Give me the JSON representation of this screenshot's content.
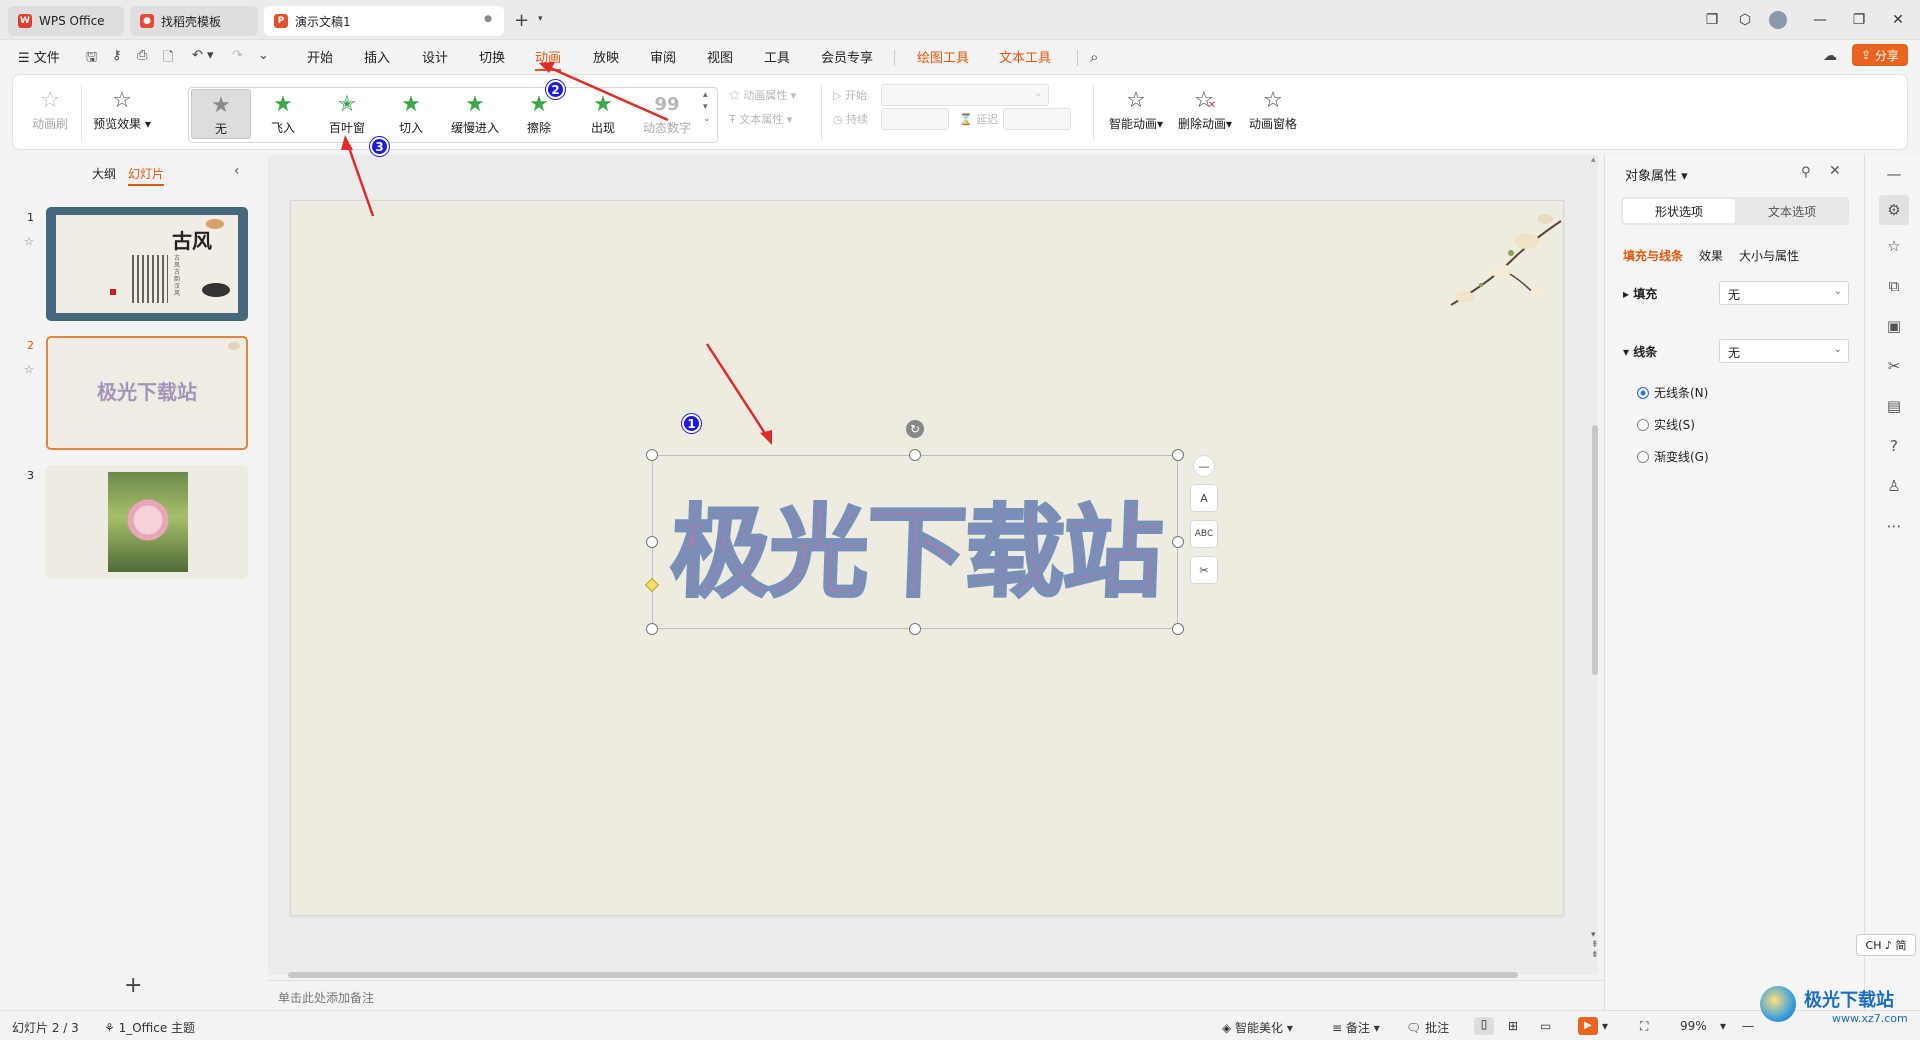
{
  "tabs": [
    {
      "label": "WPS Office",
      "icon": "wps-logo-icon"
    },
    {
      "label": "找稻壳模板",
      "icon": "docer-icon"
    },
    {
      "label": "演示文稿1",
      "icon": "presentation-icon"
    }
  ],
  "menu": {
    "file": "文件",
    "items": [
      "开始",
      "插入",
      "设计",
      "切换",
      "动画",
      "放映",
      "审阅",
      "视图",
      "工具",
      "会员专享"
    ],
    "context_items": [
      "绘图工具",
      "文本工具"
    ],
    "active": "动画",
    "share": "分享"
  },
  "ribbon": {
    "animation_brush": "动画刷",
    "preview": "预览效果",
    "gallery": [
      "无",
      "飞入",
      "百叶窗",
      "切入",
      "缓慢进入",
      "擦除",
      "出现",
      "动态数字"
    ],
    "selected": "无",
    "anim_props": "动画属性",
    "text_props": "文本属性",
    "start": "开始",
    "duration": "持续",
    "delay": "延迟",
    "smart_anim": "智能动画",
    "delete_anim": "删除动画",
    "anim_pane": "动画窗格"
  },
  "left_panel": {
    "outline_tab": "大纲",
    "slides_tab": "幻灯片",
    "slides": [
      {
        "num": "1",
        "title": "古风",
        "subtitle": "古风古韵汉风"
      },
      {
        "num": "2",
        "title": "极光下载站"
      },
      {
        "num": "3"
      }
    ]
  },
  "slide": {
    "text": "极光下载站",
    "notes_placeholder": "单击此处添加备注"
  },
  "markers": [
    "1",
    "2",
    "3"
  ],
  "right_panel": {
    "title": "对象属性",
    "tabs": [
      "形状选项",
      "文本选项"
    ],
    "subtabs": [
      "填充与线条",
      "效果",
      "大小与属性"
    ],
    "fill_label": "填充",
    "fill_value": "无",
    "line_label": "线条",
    "line_value": "无",
    "line_options": [
      "无线条(N)",
      "实线(S)",
      "渐变线(G)"
    ]
  },
  "ime": "CH ♪ 简",
  "status": {
    "slide_count": "幻灯片 2 / 3",
    "theme": "1_Office 主题",
    "beautify": "智能美化",
    "notes": "备注",
    "comments": "批注",
    "zoom": "99%"
  },
  "watermark": {
    "text": "极光下载站",
    "url": "www.xz7.com"
  },
  "colors": {
    "accent": "#e0590f",
    "selected_border": "#e8823c",
    "marker": "#1a1ae6",
    "arrow": "#e02b2b",
    "wordart_fill": "#b07aaa",
    "wordart_stroke": "#7a8fb8"
  }
}
